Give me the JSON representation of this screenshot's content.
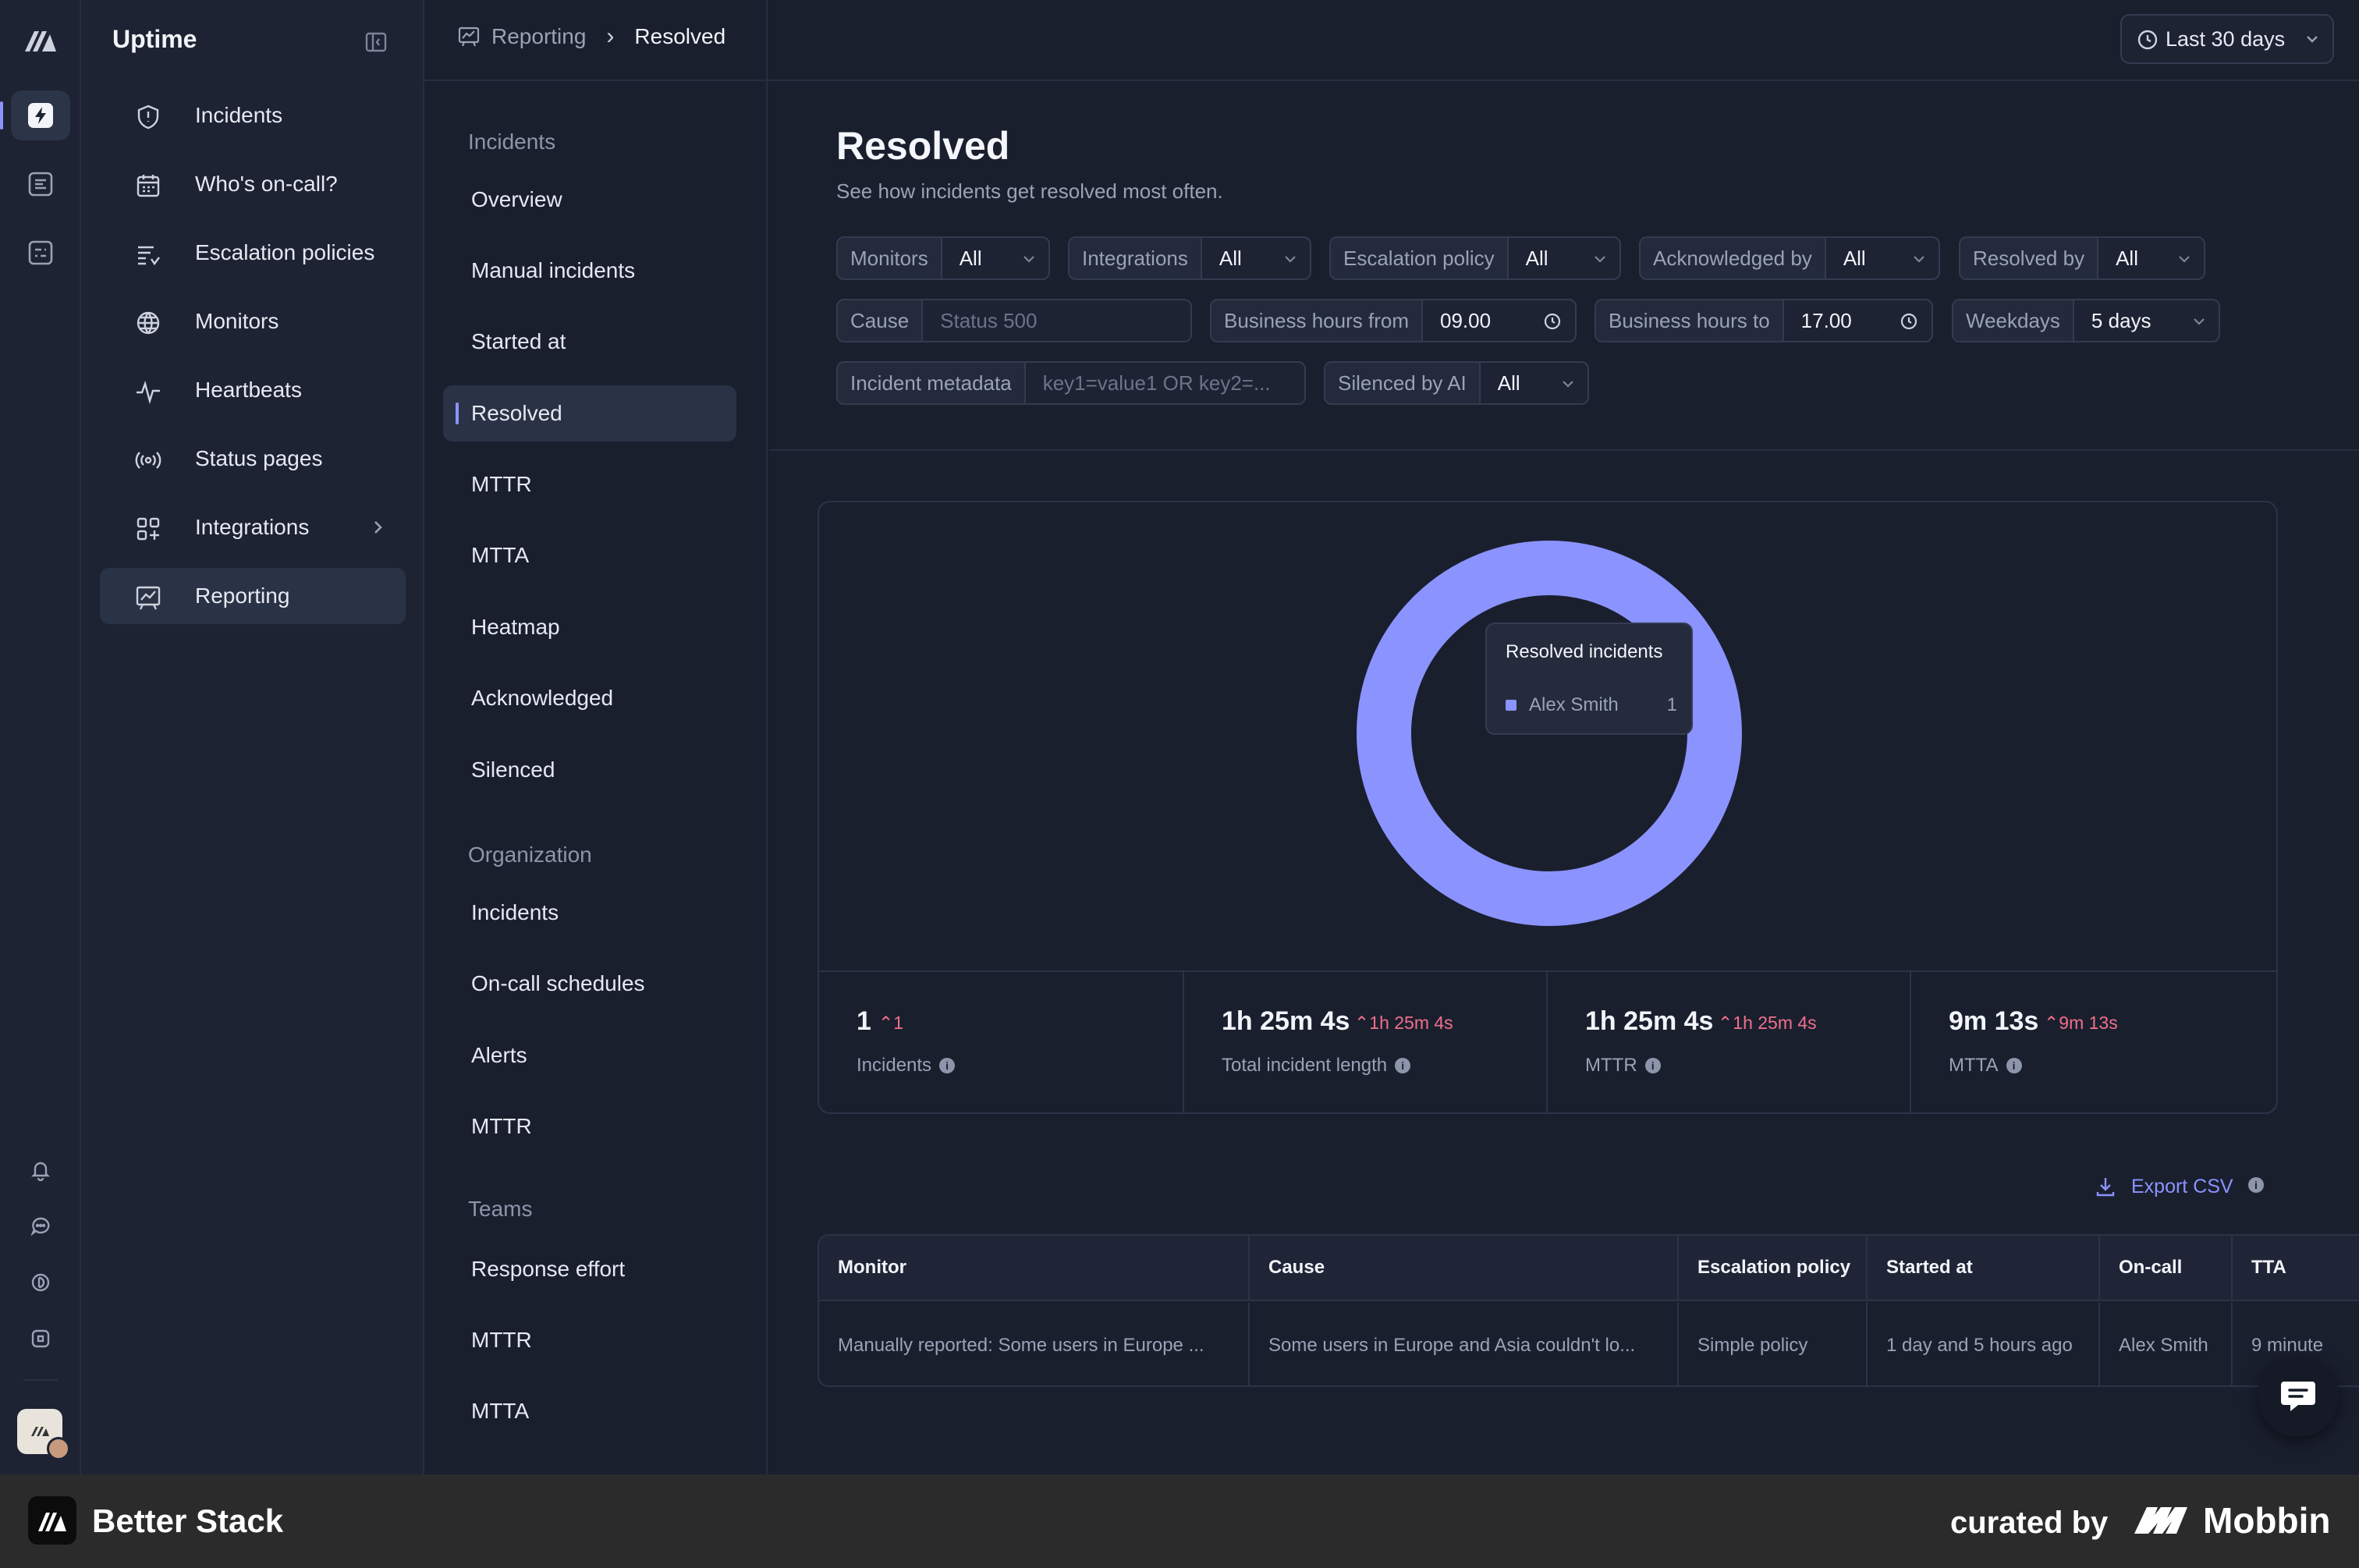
{
  "app": {
    "name": "Uptime"
  },
  "main_nav": [
    {
      "label": "Incidents",
      "icon": "shield-icon"
    },
    {
      "label": "Who's on-call?",
      "icon": "calendar-icon"
    },
    {
      "label": "Escalation policies",
      "icon": "list-icon"
    },
    {
      "label": "Monitors",
      "icon": "globe-icon"
    },
    {
      "label": "Heartbeats",
      "icon": "pulse-icon"
    },
    {
      "label": "Status pages",
      "icon": "broadcast-icon"
    },
    {
      "label": "Integrations",
      "icon": "grid-plus-icon"
    },
    {
      "label": "Reporting",
      "icon": "chart-board-icon",
      "active": true
    }
  ],
  "breadcrumb": {
    "section": "Reporting",
    "current": "Resolved"
  },
  "date_range": {
    "label": "Last 30 days"
  },
  "sub_nav": {
    "groups": [
      {
        "heading": "Incidents",
        "items": [
          "Overview",
          "Manual incidents",
          "Started at",
          "Resolved",
          "MTTR",
          "MTTA",
          "Heatmap",
          "Acknowledged",
          "Silenced"
        ]
      },
      {
        "heading": "Organization",
        "items": [
          "Incidents",
          "On-call schedules",
          "Alerts",
          "MTTR"
        ]
      },
      {
        "heading": "Teams",
        "items": [
          "Response effort",
          "MTTR",
          "MTTA"
        ]
      }
    ],
    "active": "Resolved"
  },
  "page": {
    "title": "Resolved",
    "description": "See how incidents get resolved most often."
  },
  "filters": {
    "monitors": {
      "label": "Monitors",
      "value": "All"
    },
    "integrations": {
      "label": "Integrations",
      "value": "All"
    },
    "escalation_policy": {
      "label": "Escalation policy",
      "value": "All"
    },
    "acknowledged_by": {
      "label": "Acknowledged by",
      "value": "All"
    },
    "resolved_by": {
      "label": "Resolved by",
      "value": "All"
    },
    "cause": {
      "label": "Cause",
      "placeholder": "Status 500"
    },
    "business_from": {
      "label": "Business hours from",
      "value": "09.00"
    },
    "business_to": {
      "label": "Business hours to",
      "value": "17.00"
    },
    "weekdays": {
      "label": "Weekdays",
      "value": "5 days"
    },
    "incident_metadata": {
      "label": "Incident metadata",
      "placeholder": "key1=value1 OR key2=..."
    },
    "silenced_by_ai": {
      "label": "Silenced by AI",
      "value": "All"
    }
  },
  "chart_data": {
    "type": "pie",
    "title": "Resolved incidents",
    "series": [
      {
        "name": "Alex Smith",
        "value": 1,
        "color": "#8b93ff"
      }
    ]
  },
  "tooltip": {
    "title": "Resolved incidents",
    "name": "Alex Smith",
    "value": "1"
  },
  "stats": [
    {
      "value": "1",
      "delta": "1",
      "label": "Incidents"
    },
    {
      "value": "1h 25m 4s",
      "delta": "1h 25m 4s",
      "label": "Total incident length"
    },
    {
      "value": "1h 25m 4s",
      "delta": "1h 25m 4s",
      "label": "MTTR"
    },
    {
      "value": "9m 13s",
      "delta": "9m 13s",
      "label": "MTTA"
    }
  ],
  "export": {
    "label": "Export CSV"
  },
  "table": {
    "columns": [
      "Monitor",
      "Cause",
      "Escalation policy",
      "Started at",
      "On-call",
      "TTA"
    ],
    "rows": [
      [
        "Manually reported: Some users in Europe ...",
        "Some users in Europe and Asia couldn't lo...",
        "Simple policy",
        "1 day and 5 hours ago",
        "Alex Smith",
        "9 minute"
      ]
    ]
  },
  "footer": {
    "brand": "Better Stack",
    "curated": "curated by",
    "mobbin": "Mobbin"
  },
  "colors": {
    "accent": "#8b93ff",
    "negative_delta": "#f0708a",
    "background": "#1a1f2e"
  }
}
